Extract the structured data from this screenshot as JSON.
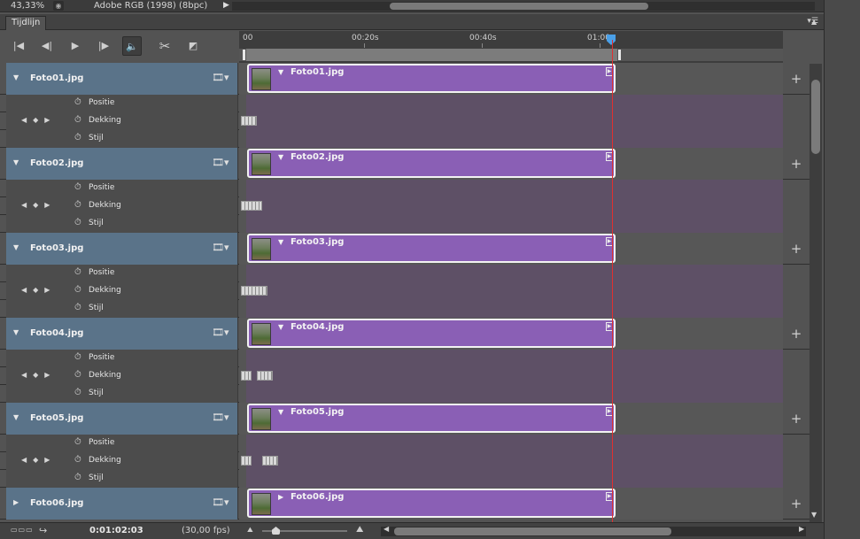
{
  "status": {
    "zoom": "43,33%",
    "profile": "Adobe RGB (1998) (8bpc)"
  },
  "panel": {
    "tab_label": "Tijdlijn"
  },
  "ruler": {
    "labels": [
      "00",
      "00:20s",
      "00:40s",
      "01:00"
    ]
  },
  "layers": [
    {
      "name": "Foto01.jpg",
      "clip": "Foto01.jpg",
      "expanded": true,
      "keyframes": [
        [
          2,
          3
        ]
      ]
    },
    {
      "name": "Foto02.jpg",
      "clip": "Foto02.jpg",
      "expanded": true,
      "keyframes": [
        [
          2,
          4
        ]
      ]
    },
    {
      "name": "Foto03.jpg",
      "clip": "Foto03.jpg",
      "expanded": true,
      "keyframes": [
        [
          2,
          5
        ]
      ]
    },
    {
      "name": "Foto04.jpg",
      "clip": "Foto04.jpg",
      "expanded": true,
      "keyframes": [
        [
          2,
          2
        ],
        [
          20,
          3
        ]
      ]
    },
    {
      "name": "Foto05.jpg",
      "clip": "Foto05.jpg",
      "expanded": true,
      "keyframes": [
        [
          2,
          2
        ],
        [
          26,
          3
        ]
      ]
    },
    {
      "name": "Foto06.jpg",
      "clip": "Foto06.jpg",
      "expanded": false,
      "keyframes": []
    }
  ],
  "properties": [
    "Positie",
    "Dekking",
    "Stijl"
  ],
  "bottom": {
    "timecode": "0:01:02:03",
    "fps": "(30,00 fps)"
  }
}
